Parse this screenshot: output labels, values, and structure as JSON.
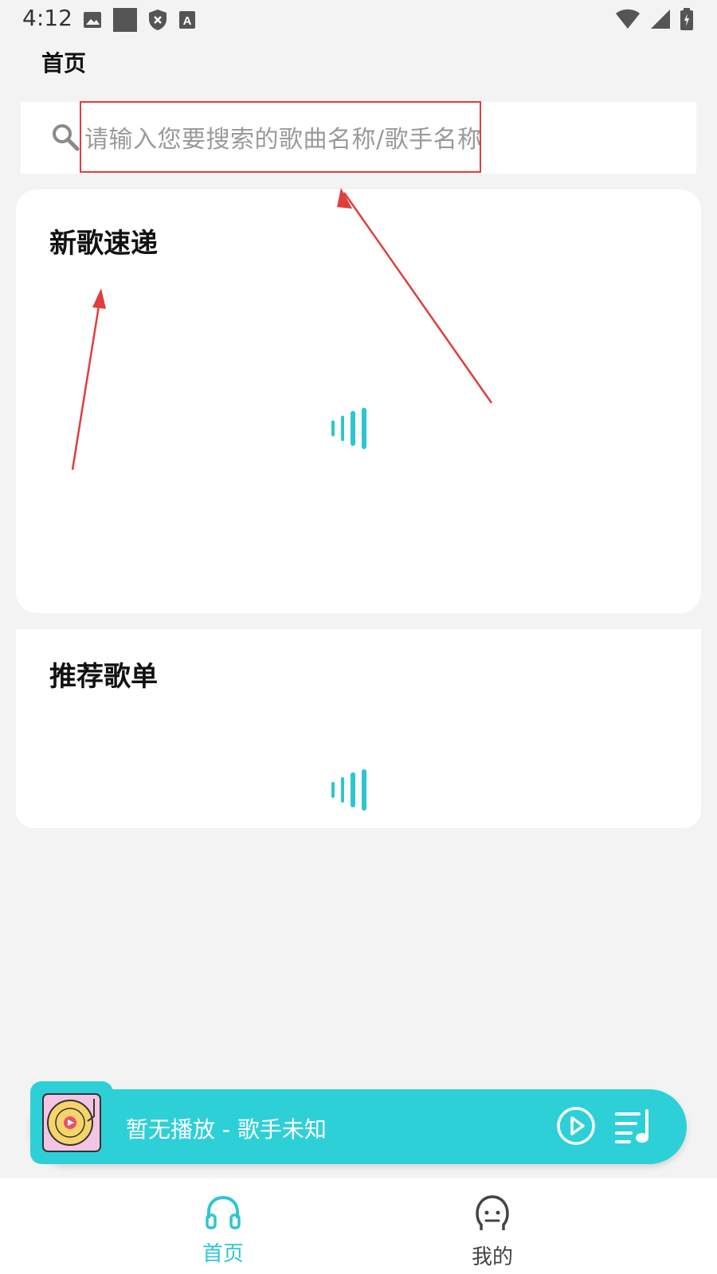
{
  "status_bar": {
    "time": "4:12",
    "icons": [
      "image-icon",
      "square-icon",
      "shield-icon",
      "keyboard-a-icon"
    ],
    "right_icons": [
      "wifi-icon",
      "signal-icon",
      "battery-icon"
    ]
  },
  "header": {
    "title": "首页"
  },
  "search": {
    "placeholder": "请输入您要搜索的歌曲名称/歌手名称",
    "icon": "search-icon"
  },
  "sections": {
    "new_songs": {
      "title": "新歌速递"
    },
    "recommended": {
      "title": "推荐歌单"
    }
  },
  "player": {
    "now_playing": "暂无播放 - 歌手未知",
    "controls": [
      "play-icon",
      "playlist-icon"
    ]
  },
  "bottom_nav": {
    "items": [
      {
        "label": "首页",
        "icon": "headphones-icon",
        "active": true
      },
      {
        "label": "我的",
        "icon": "user-face-icon",
        "active": false
      }
    ]
  },
  "colors": {
    "accent": "#2ed0d8",
    "annotation": "#e03d3d",
    "background": "#f3f3f3"
  }
}
